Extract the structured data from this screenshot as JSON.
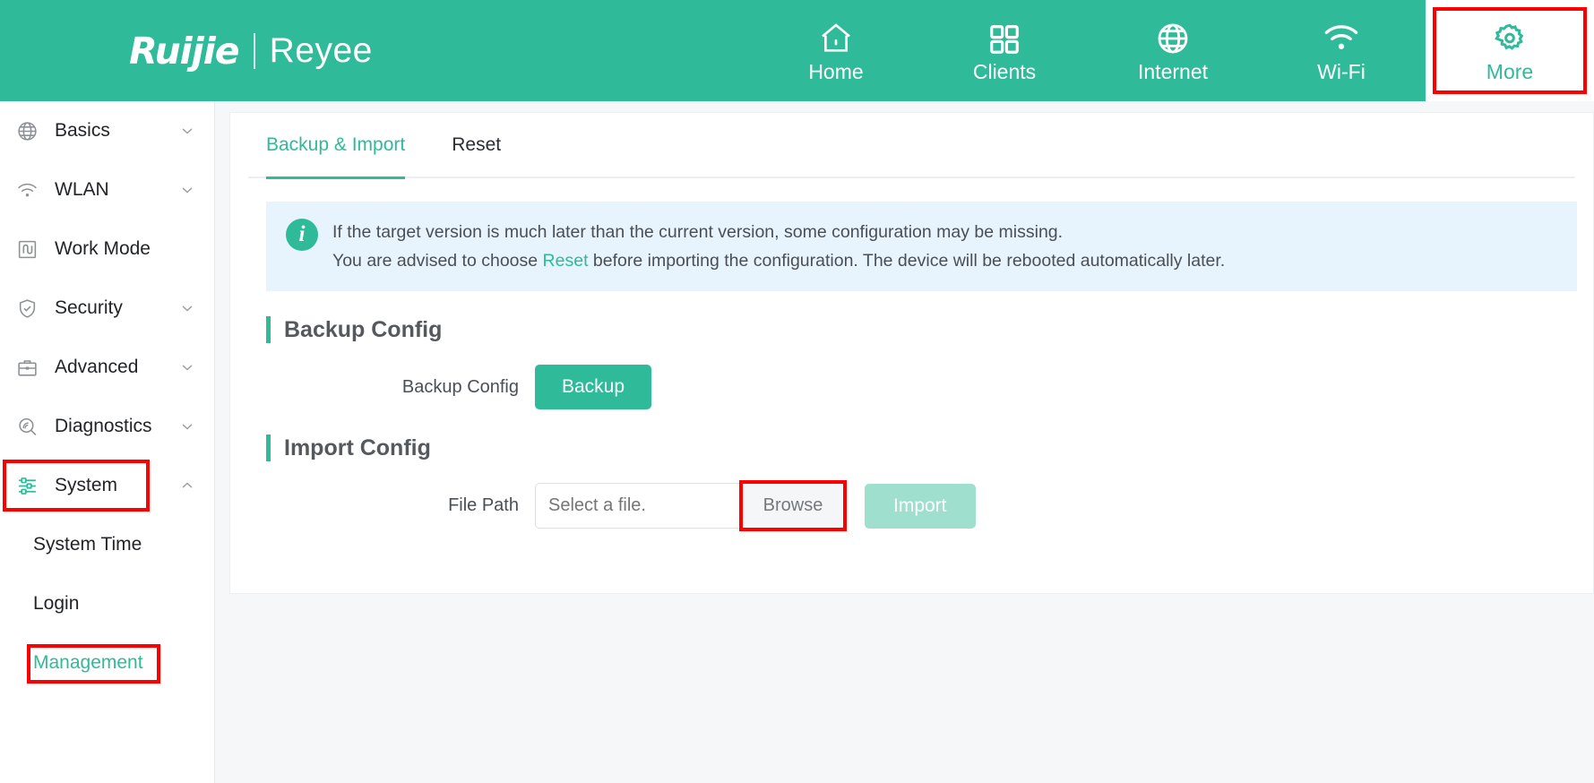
{
  "brand": {
    "primary": "Ruijie",
    "secondary": "Reyee"
  },
  "colors": {
    "accent": "#2fba99",
    "highlight": "#ff0000",
    "info_bg": "#e8f4fd",
    "disabled_button": "#9fdfcd"
  },
  "topnav": [
    {
      "label": "Home",
      "icon": "home-icon",
      "active": false
    },
    {
      "label": "Clients",
      "icon": "grid-icon",
      "active": false
    },
    {
      "label": "Internet",
      "icon": "globe-icon",
      "active": false
    },
    {
      "label": "Wi-Fi",
      "icon": "wifi-icon",
      "active": false
    },
    {
      "label": "More",
      "icon": "gear-icon",
      "active": true,
      "highlighted": true
    }
  ],
  "sidebar": {
    "items": [
      {
        "label": "Basics",
        "icon": "globe-icon",
        "expandable": true,
        "expanded": false
      },
      {
        "label": "WLAN",
        "icon": "wifi-icon",
        "expandable": true,
        "expanded": false
      },
      {
        "label": "Work Mode",
        "icon": "work-mode-icon",
        "expandable": false
      },
      {
        "label": "Security",
        "icon": "shield-check-icon",
        "expandable": true,
        "expanded": false
      },
      {
        "label": "Advanced",
        "icon": "briefcase-icon",
        "expandable": true,
        "expanded": false
      },
      {
        "label": "Diagnostics",
        "icon": "diagnostics-icon",
        "expandable": true,
        "expanded": false
      },
      {
        "label": "System",
        "icon": "sliders-icon",
        "expandable": true,
        "expanded": true,
        "highlighted": true
      }
    ],
    "subitems": [
      {
        "label": "System Time",
        "active": false
      },
      {
        "label": "Login",
        "active": false
      },
      {
        "label": "Management",
        "active": true,
        "highlighted": true
      }
    ]
  },
  "main": {
    "tabs": [
      {
        "label": "Backup & Import",
        "active": true
      },
      {
        "label": "Reset",
        "active": false
      }
    ],
    "info": {
      "icon": "info-icon",
      "line1": "If the target version is much later than the current version, some configuration may be missing.",
      "line2_pre": "You are advised to choose ",
      "line2_link": "Reset",
      "line2_post": " before importing the configuration. The device will be rebooted automatically later."
    },
    "backup_section": {
      "title": "Backup Config",
      "row_label": "Backup Config",
      "button_label": "Backup"
    },
    "import_section": {
      "title": "Import Config",
      "row_label": "File Path",
      "file_value": "",
      "file_placeholder": "Select a file.",
      "browse_label": "Browse",
      "import_label": "Import"
    }
  }
}
